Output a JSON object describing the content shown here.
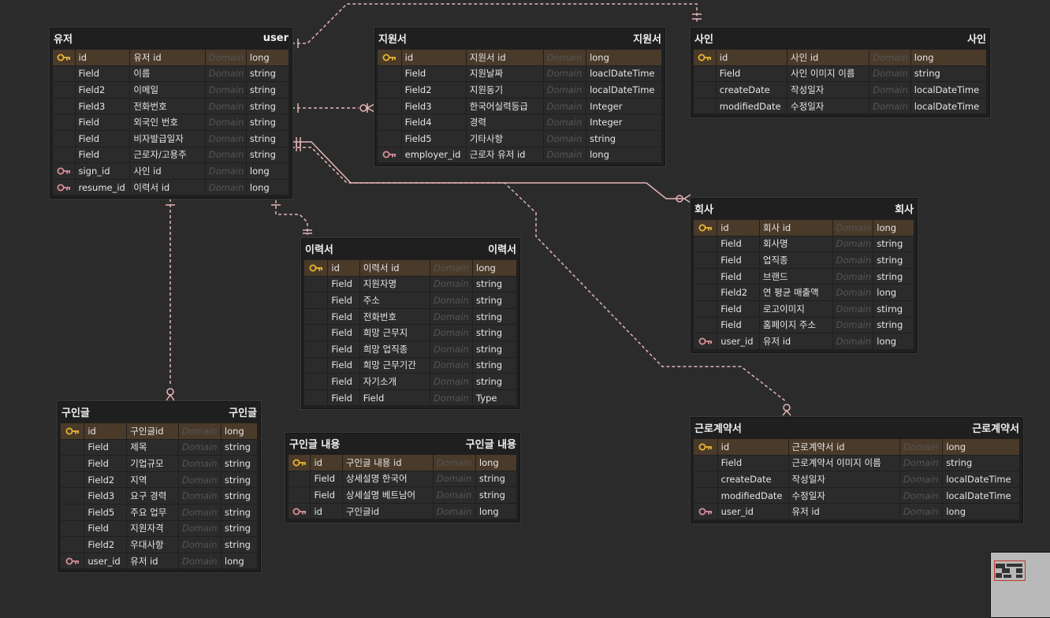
{
  "colors": {
    "canvas": "#2b2b2b",
    "link": "#e8b4b8",
    "pk_row": "#4a3a2a",
    "pk_key": "#e6b530",
    "fk_key": "#d88f99"
  },
  "tables": {
    "user": {
      "title": "유저",
      "name": "user",
      "cols": [
        {
          "icon": "pk",
          "name": "id",
          "label": "유저 id",
          "domain": "Domain",
          "type": "long"
        },
        {
          "icon": "",
          "name": "Field",
          "label": "이름",
          "domain": "Domain",
          "type": "string"
        },
        {
          "icon": "",
          "name": "Field2",
          "label": "이메일",
          "domain": "Domain",
          "type": "string"
        },
        {
          "icon": "",
          "name": "Field3",
          "label": "전화번호",
          "domain": "Domain",
          "type": "string"
        },
        {
          "icon": "",
          "name": "Field",
          "label": "외국인 번호",
          "domain": "Domain",
          "type": "string"
        },
        {
          "icon": "",
          "name": "Field",
          "label": "비자발급일자",
          "domain": "Domain",
          "type": "string"
        },
        {
          "icon": "",
          "name": "Field",
          "label": "근로자/고용주",
          "domain": "Domain",
          "type": "string"
        },
        {
          "icon": "fk",
          "name": "sign_id",
          "label": "사인 id",
          "domain": "Domain",
          "type": "long"
        },
        {
          "icon": "fk",
          "name": "resume_id",
          "label": "이력서 id",
          "domain": "Domain",
          "type": "long"
        }
      ]
    },
    "application": {
      "title": "지원서",
      "name": "지원서",
      "cols": [
        {
          "icon": "pk",
          "name": "id",
          "label": "지원서 id",
          "domain": "Domain",
          "type": "long"
        },
        {
          "icon": "",
          "name": "Field",
          "label": "지원날짜",
          "domain": "Domain",
          "type": "loaclDateTime"
        },
        {
          "icon": "",
          "name": "Field2",
          "label": "지원동기",
          "domain": "Domain",
          "type": "localDateTime"
        },
        {
          "icon": "",
          "name": "Field3",
          "label": "한국어실력등급",
          "domain": "Domain",
          "type": "Integer"
        },
        {
          "icon": "",
          "name": "Field4",
          "label": "경력",
          "domain": "Domain",
          "type": "Integer"
        },
        {
          "icon": "",
          "name": "Field5",
          "label": "기타사항",
          "domain": "Domain",
          "type": "string"
        },
        {
          "icon": "fk",
          "name": "employer_id",
          "label": "근로자 유저 id",
          "domain": "Domain",
          "type": "long"
        }
      ]
    },
    "sign": {
      "title": "사인",
      "name": "사인",
      "cols": [
        {
          "icon": "pk",
          "name": "id",
          "label": "사인 id",
          "domain": "Domain",
          "type": "long"
        },
        {
          "icon": "",
          "name": "Field",
          "label": "사인 이미지 이름",
          "domain": "Domain",
          "type": "string"
        },
        {
          "icon": "",
          "name": "createDate",
          "label": "작성일자",
          "domain": "Domain",
          "type": "localDateTime"
        },
        {
          "icon": "",
          "name": "modifiedDate",
          "label": "수정일자",
          "domain": "Domain",
          "type": "localDateTime"
        }
      ]
    },
    "company": {
      "title": "회사",
      "name": "회사",
      "cols": [
        {
          "icon": "pk",
          "name": "id",
          "label": "회사 id",
          "domain": "Domain",
          "type": "long"
        },
        {
          "icon": "",
          "name": "Field",
          "label": "회사명",
          "domain": "Domain",
          "type": "string"
        },
        {
          "icon": "",
          "name": "Field",
          "label": "업직종",
          "domain": "Domain",
          "type": "string"
        },
        {
          "icon": "",
          "name": "Field",
          "label": "브랜드",
          "domain": "Domain",
          "type": "string"
        },
        {
          "icon": "",
          "name": "Field2",
          "label": "연 평균 매출액",
          "domain": "Domain",
          "type": "long"
        },
        {
          "icon": "",
          "name": "Field",
          "label": "로고이미지",
          "domain": "Domain",
          "type": "stirng"
        },
        {
          "icon": "",
          "name": "Field",
          "label": "홈페이지 주소",
          "domain": "Domain",
          "type": "string"
        },
        {
          "icon": "fk",
          "name": "user_id",
          "label": "유저 id",
          "domain": "Domain",
          "type": "long"
        }
      ]
    },
    "resume": {
      "title": "이력서",
      "name": "이력서",
      "cols": [
        {
          "icon": "pk",
          "name": "id",
          "label": "이력서 id",
          "domain": "Domain",
          "type": "long"
        },
        {
          "icon": "",
          "name": "Field",
          "label": "지원자명",
          "domain": "Domain",
          "type": "string"
        },
        {
          "icon": "",
          "name": "Field",
          "label": "주소",
          "domain": "Domain",
          "type": "string"
        },
        {
          "icon": "",
          "name": "Field",
          "label": "전화번호",
          "domain": "Domain",
          "type": "string"
        },
        {
          "icon": "",
          "name": "Field",
          "label": "희망 근무지",
          "domain": "Domain",
          "type": "string"
        },
        {
          "icon": "",
          "name": "Field",
          "label": "희망 업직종",
          "domain": "Domain",
          "type": "string"
        },
        {
          "icon": "",
          "name": "Field",
          "label": "희망 근무기간",
          "domain": "Domain",
          "type": "string"
        },
        {
          "icon": "",
          "name": "Field",
          "label": "자기소개",
          "domain": "Domain",
          "type": "string"
        },
        {
          "icon": "",
          "name": "Field",
          "label": "Field",
          "domain": "Domain",
          "type": "Type"
        }
      ]
    },
    "job_post": {
      "title": "구인글",
      "name": "구인글",
      "cols": [
        {
          "icon": "pk",
          "name": "id",
          "label": "구인글id",
          "domain": "Domain",
          "type": "long"
        },
        {
          "icon": "",
          "name": "Field",
          "label": "제목",
          "domain": "Domain",
          "type": "string"
        },
        {
          "icon": "",
          "name": "Field",
          "label": "기업규모",
          "domain": "Domain",
          "type": "string"
        },
        {
          "icon": "",
          "name": "Field2",
          "label": "지역",
          "domain": "Domain",
          "type": "string"
        },
        {
          "icon": "",
          "name": "Field3",
          "label": "요구 경력",
          "domain": "Domain",
          "type": "string"
        },
        {
          "icon": "",
          "name": "Field5",
          "label": "주요 업무",
          "domain": "Domain",
          "type": "string"
        },
        {
          "icon": "",
          "name": "Field",
          "label": "지원자격",
          "domain": "Domain",
          "type": "string"
        },
        {
          "icon": "",
          "name": "Field2",
          "label": "우대사항",
          "domain": "Domain",
          "type": "string"
        },
        {
          "icon": "fk",
          "name": "user_id",
          "label": "유저 id",
          "domain": "Domain",
          "type": "long"
        }
      ]
    },
    "job_post_content": {
      "title": "구인글 내용",
      "name": "구인글 내용",
      "cols": [
        {
          "icon": "pk",
          "name": "id",
          "label": "구인글 내용 id",
          "domain": "Domain",
          "type": "long"
        },
        {
          "icon": "",
          "name": "Field",
          "label": "상세설명 한국어",
          "domain": "Domain",
          "type": "string"
        },
        {
          "icon": "",
          "name": "Field",
          "label": "상세설명 베트남어",
          "domain": "Domain",
          "type": "string"
        },
        {
          "icon": "fk",
          "name": "id",
          "label": "구인글id",
          "domain": "Domain",
          "type": "long"
        }
      ]
    },
    "contract": {
      "title": "근로계약서",
      "name": "근로계약서",
      "cols": [
        {
          "icon": "pk",
          "name": "id",
          "label": "근로계약서 id",
          "domain": "Domain",
          "type": "long"
        },
        {
          "icon": "",
          "name": "Field",
          "label": "근로계약서 이미지 이름",
          "domain": "Domain",
          "type": "string"
        },
        {
          "icon": "",
          "name": "createDate",
          "label": "작성일자",
          "domain": "Domain",
          "type": "localDateTime"
        },
        {
          "icon": "",
          "name": "modifiedDate",
          "label": "수정일자",
          "domain": "Domain",
          "type": "localDateTime"
        },
        {
          "icon": "fk",
          "name": "user_id",
          "label": "유저 id",
          "domain": "Domain",
          "type": "long"
        }
      ]
    }
  }
}
